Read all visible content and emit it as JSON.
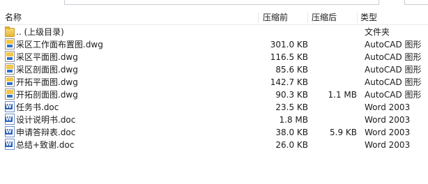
{
  "columns": {
    "name": "名称",
    "size": "压缩前",
    "compressed": "压缩后",
    "type": "类型"
  },
  "files": [
    {
      "icon": "folder-up-icon",
      "kind": "folder",
      "name": ".. (上级目录)",
      "size": "",
      "compressed": "",
      "type": "文件夹"
    },
    {
      "icon": "dwg-file-icon",
      "kind": "dwg",
      "name": "采区工作面布置图.dwg",
      "size": "301.0 KB",
      "compressed": "",
      "type": "AutoCAD 图形"
    },
    {
      "icon": "dwg-file-icon",
      "kind": "dwg",
      "name": "采区平面图.dwg",
      "size": "116.5 KB",
      "compressed": "",
      "type": "AutoCAD 图形"
    },
    {
      "icon": "dwg-file-icon",
      "kind": "dwg",
      "name": "采区剖面图.dwg",
      "size": "85.6 KB",
      "compressed": "",
      "type": "AutoCAD 图形"
    },
    {
      "icon": "dwg-file-icon",
      "kind": "dwg",
      "name": "开拓平面图.dwg",
      "size": "142.7 KB",
      "compressed": "",
      "type": "AutoCAD 图形"
    },
    {
      "icon": "dwg-file-icon",
      "kind": "dwg",
      "name": "开拓剖面图.dwg",
      "size": "90.3 KB",
      "compressed": "1.1 MB",
      "type": "AutoCAD 图形"
    },
    {
      "icon": "word-doc-icon",
      "kind": "doc",
      "name": "任务书.doc",
      "size": "23.5 KB",
      "compressed": "",
      "type": "Word 2003"
    },
    {
      "icon": "word-doc-icon",
      "kind": "doc",
      "name": "设计说明书.doc",
      "size": "1.8 MB",
      "compressed": "",
      "type": "Word 2003"
    },
    {
      "icon": "word-doc-icon",
      "kind": "doc",
      "name": "申请答辩表.doc",
      "size": "38.0 KB",
      "compressed": "5.9 KB",
      "type": "Word 2003"
    },
    {
      "icon": "word-doc-icon",
      "kind": "doc",
      "name": "总结+致谢.doc",
      "size": "26.0 KB",
      "compressed": "",
      "type": "Word 2003"
    }
  ]
}
